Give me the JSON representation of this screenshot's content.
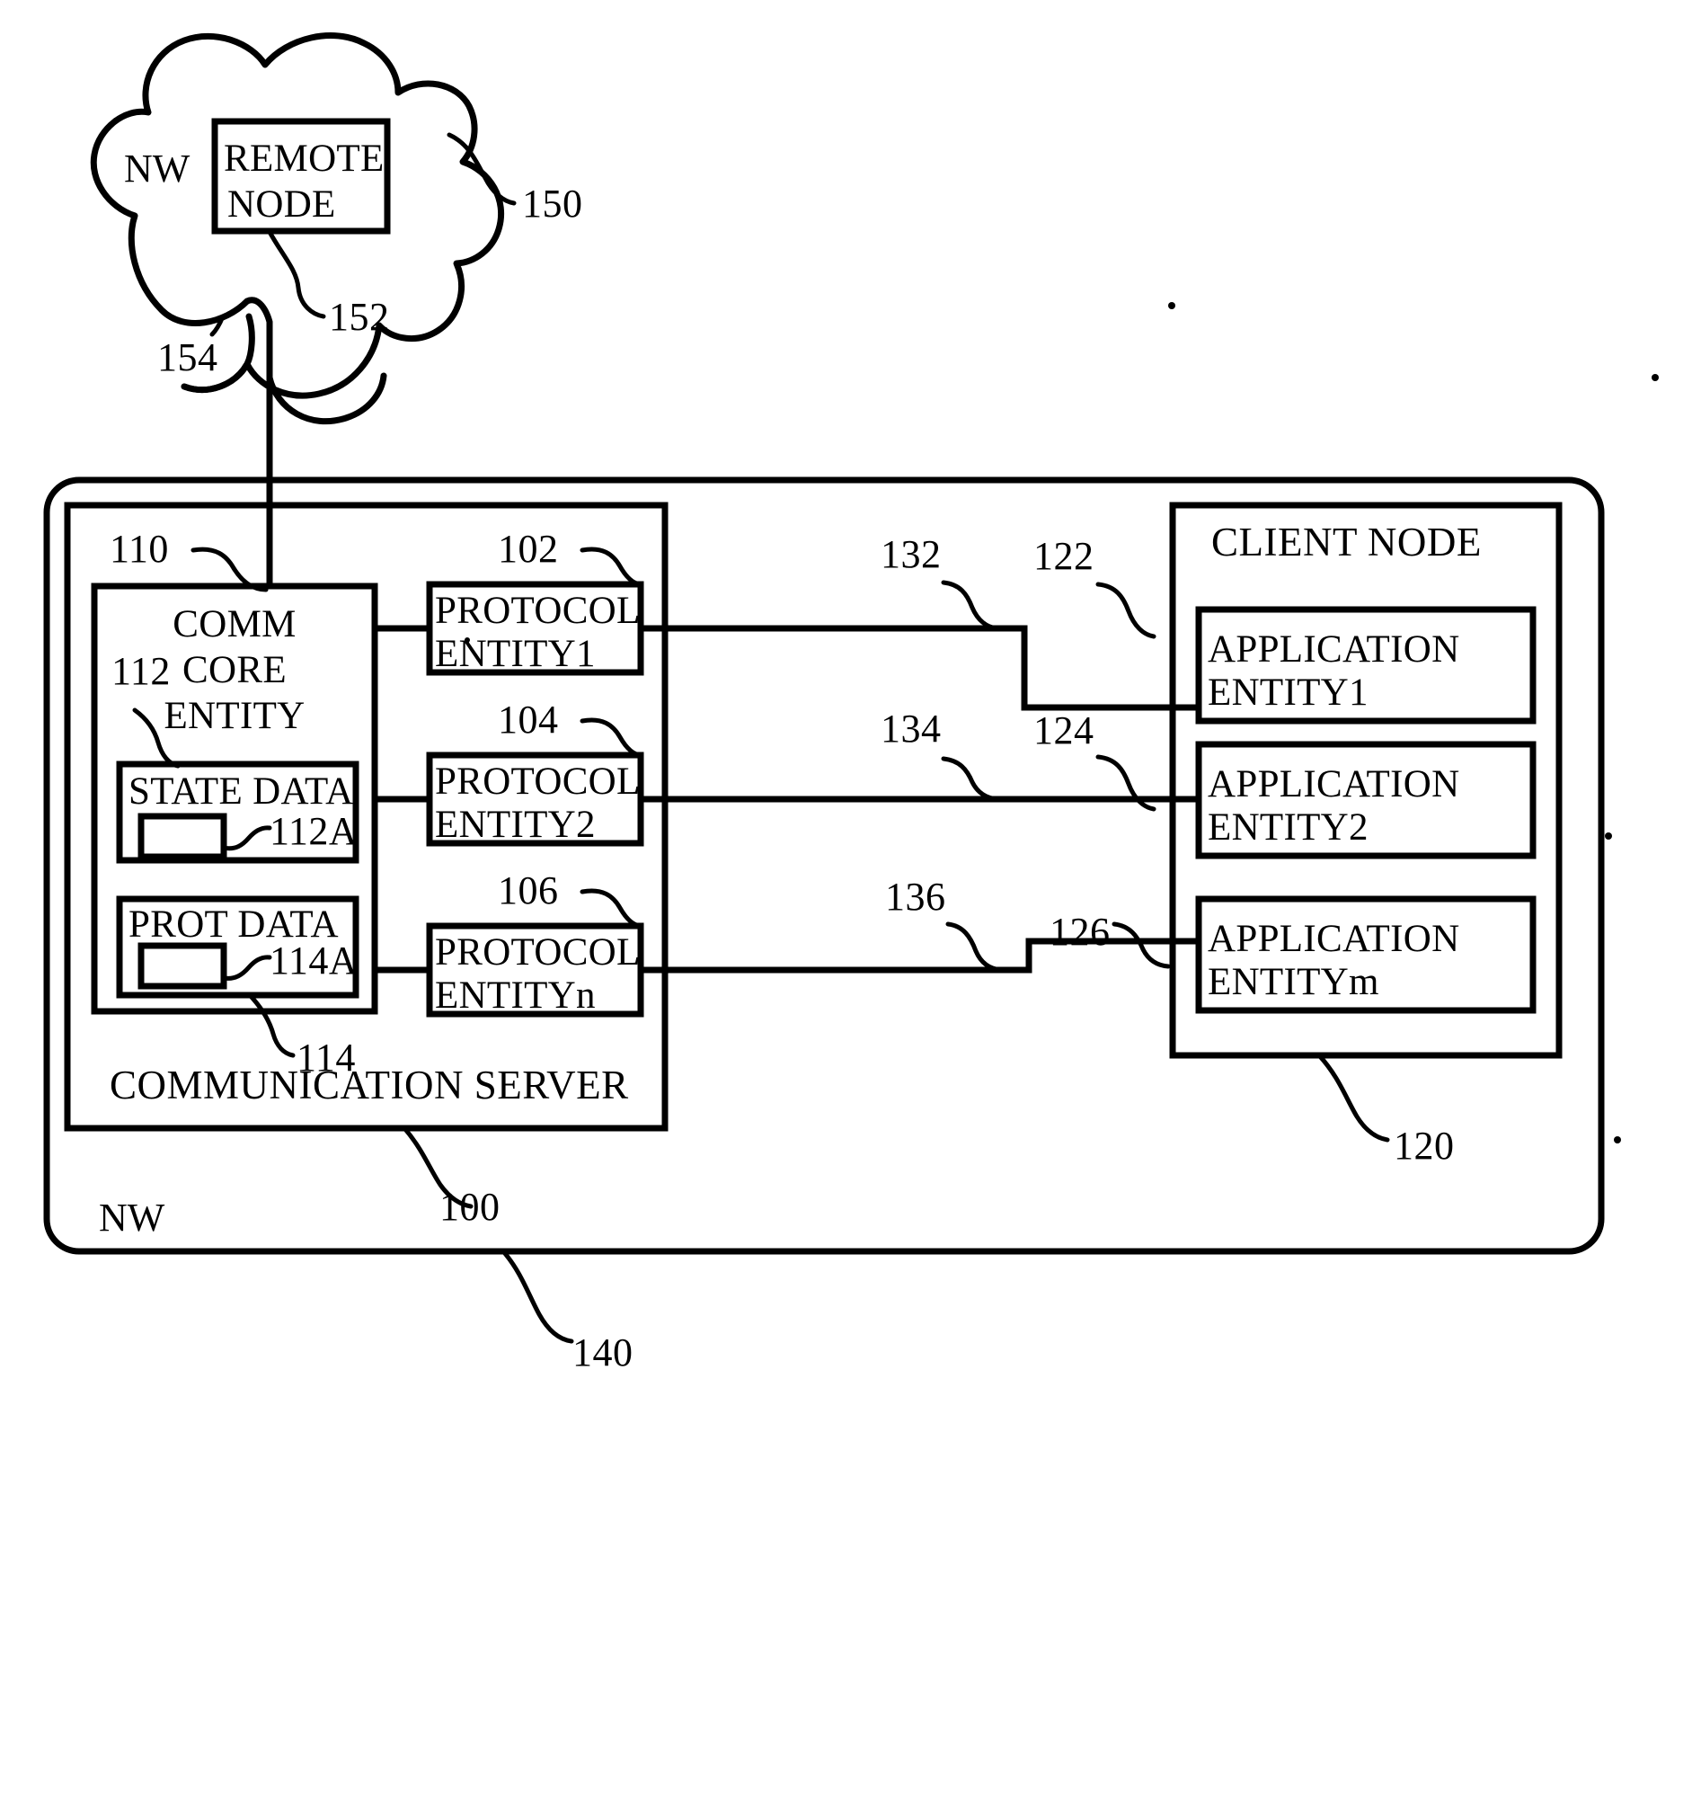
{
  "figure": {
    "type": "patent-block-diagram",
    "domain": "network communication architecture"
  },
  "cloud": {
    "network_label": "NW",
    "ref_cloud": "150",
    "ref_link": "154",
    "remote_node": {
      "label_line1": "REMOTE",
      "label_line2": "NODE",
      "ref": "152"
    }
  },
  "outer_network": {
    "network_label": "NW",
    "ref": "140"
  },
  "communication_server": {
    "title": "COMMUNICATION SERVER",
    "ref": "100",
    "comm_core_entity": {
      "line1": "COMM",
      "line2": "CORE",
      "line3": "ENTITY",
      "ref": "110"
    },
    "state_data": {
      "label": "STATE DATA",
      "ref_block": "112",
      "ref_inner": "112A"
    },
    "prot_data": {
      "label": "PROT DATA",
      "ref_block": "114",
      "ref_inner": "114A"
    },
    "protocol_entities": [
      {
        "line1": "PROTOCOL",
        "line2": "ENTITY1",
        "ref": "102"
      },
      {
        "line1": "PROTOCOL",
        "line2": "ENTITY2",
        "ref": "104"
      },
      {
        "line1": "PROTOCOL",
        "line2": "ENTITYn",
        "ref": "106"
      }
    ]
  },
  "client_node": {
    "title": "CLIENT NODE",
    "ref": "120",
    "application_entities": [
      {
        "line1": "APPLICATION",
        "line2": "ENTITY1",
        "ref": "122"
      },
      {
        "line1": "APPLICATION",
        "line2": "ENTITY2",
        "ref": "124"
      },
      {
        "line1": "APPLICATION",
        "line2": "ENTITYm",
        "ref": "126"
      }
    ]
  },
  "connections": [
    {
      "ref": "132",
      "from": "PROTOCOL ENTITY1",
      "to": "APPLICATION ENTITY1"
    },
    {
      "ref": "134",
      "from": "PROTOCOL ENTITY2",
      "to": "APPLICATION ENTITY2"
    },
    {
      "ref": "136",
      "from": "PROTOCOL ENTITYn",
      "to": "APPLICATION ENTITYm"
    }
  ],
  "colors": {
    "ink": "#000000",
    "background": "#ffffff"
  }
}
